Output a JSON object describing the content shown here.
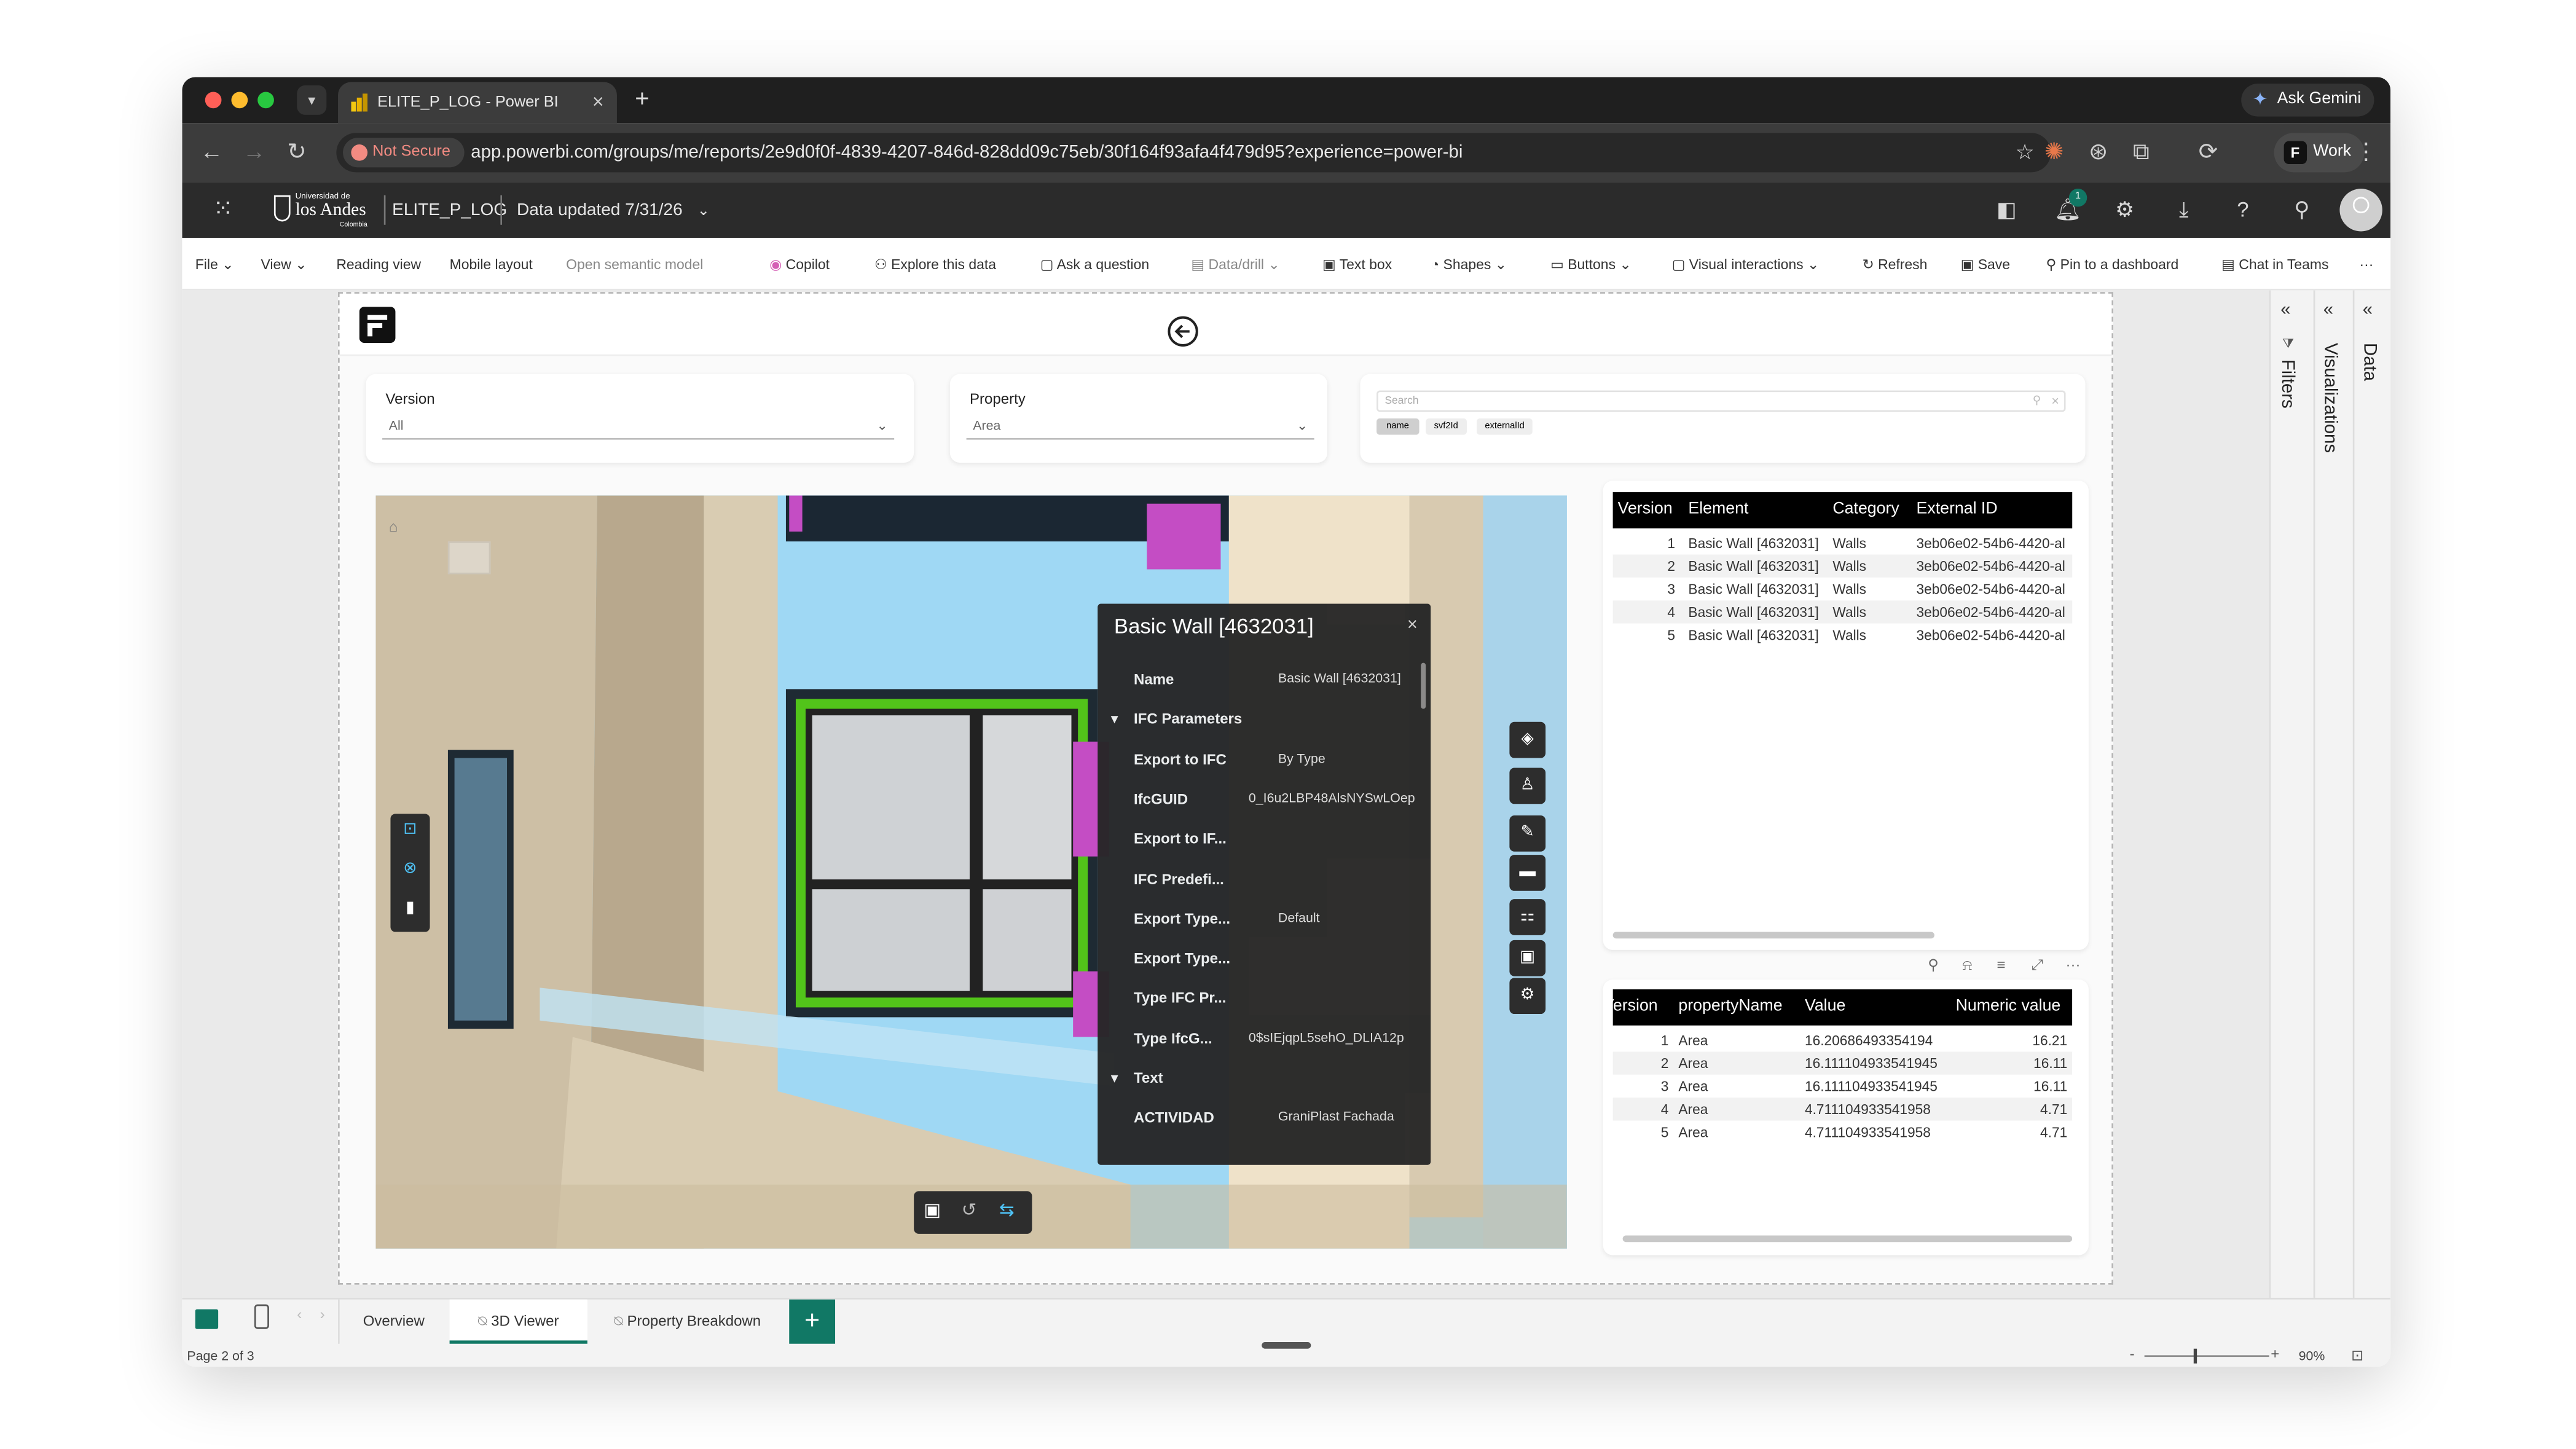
{
  "browser": {
    "tab_title": "ELITE_P_LOG - Power BI",
    "new_tab_symbol": "+",
    "tab_close_symbol": "×",
    "not_secure_label": "Not Secure",
    "url": "app.powerbi.com/groups/me/reports/2e9d0f0f-4839-4207-846d-828dd09c75eb/30f164f93afa4f479d95?experience=power-bi",
    "ask_gemini_label": "Ask Gemini",
    "profile_label": "Work"
  },
  "pbi_header": {
    "org_name_top": "Universidad de",
    "org_name_main": "los Andes",
    "org_name_sub": "Colombia",
    "report_name": "ELITE_P_LOG",
    "data_updated": "Data updated 7/31/26"
  },
  "ribbon": {
    "file": "File",
    "view": "View",
    "reading_view": "Reading view",
    "mobile_layout": "Mobile layout",
    "open_semantic_model": "Open semantic model",
    "copilot": "Copilot",
    "explore": "Explore this data",
    "ask_question": "Ask a question",
    "data_drill": "Data/drill",
    "text_box": "Text box",
    "shapes": "Shapes",
    "buttons": "Buttons",
    "visual_interactions": "Visual interactions",
    "refresh": "Refresh",
    "save": "Save",
    "pin": "Pin to a dashboard",
    "chat_teams": "Chat in Teams",
    "more": "···"
  },
  "filters": {
    "version_label": "Version",
    "version_value": "All",
    "property_label": "Property",
    "property_value": "Area",
    "search_placeholder": "Search",
    "search_chips": [
      "name",
      "svf2Id",
      "externalId"
    ]
  },
  "viewer": {
    "panel_title": "Basic Wall [4632031]",
    "rows": [
      {
        "key": "Name",
        "value": "Basic Wall [4632031]",
        "section": false
      },
      {
        "key": "IFC Parameters",
        "value": "",
        "section": true
      },
      {
        "key": "Export to IFC",
        "value": "By Type",
        "section": false
      },
      {
        "key": "IfcGUID",
        "value": "0_I6u2LBP48AlsNYSwLOep",
        "section": false
      },
      {
        "key": "Export to IF...",
        "value": "",
        "section": false
      },
      {
        "key": "IFC Predefi...",
        "value": "",
        "section": false
      },
      {
        "key": "Export Type...",
        "value": "Default",
        "section": false
      },
      {
        "key": "Export Type...",
        "value": "",
        "section": false
      },
      {
        "key": "Type IFC Pr...",
        "value": "",
        "section": false
      },
      {
        "key": "Type IfcG...",
        "value": "0$sIEjqpL5sehO_DLIA12p",
        "section": false
      },
      {
        "key": "Text",
        "value": "",
        "section": true
      },
      {
        "key": "ACTIVIDAD",
        "value": "GraniPlast Fachada",
        "section": false
      }
    ]
  },
  "elements_table": {
    "headers": [
      "Version",
      "Element",
      "Category",
      "External ID"
    ],
    "rows": [
      [
        "1",
        "Basic Wall [4632031]",
        "Walls",
        "3eb06e02-54b6-4420-al"
      ],
      [
        "2",
        "Basic Wall [4632031]",
        "Walls",
        "3eb06e02-54b6-4420-al"
      ],
      [
        "3",
        "Basic Wall [4632031]",
        "Walls",
        "3eb06e02-54b6-4420-al"
      ],
      [
        "4",
        "Basic Wall [4632031]",
        "Walls",
        "3eb06e02-54b6-4420-al"
      ],
      [
        "5",
        "Basic Wall [4632031]",
        "Walls",
        "3eb06e02-54b6-4420-al"
      ]
    ]
  },
  "property_table": {
    "headers": [
      "Version",
      "propertyName",
      "Value",
      "Numeric value"
    ],
    "rows": [
      [
        "1",
        "Area",
        "16.20686493354194",
        "16.21"
      ],
      [
        "2",
        "Area",
        "16.111104933541945",
        "16.11"
      ],
      [
        "3",
        "Area",
        "16.111104933541945",
        "16.11"
      ],
      [
        "4",
        "Area",
        "4.711104933541958",
        "4.71"
      ],
      [
        "5",
        "Area",
        "4.711104933541958",
        "4.71"
      ]
    ]
  },
  "side_panes": {
    "filters": "Filters",
    "visualizations": "Visualizations",
    "data": "Data"
  },
  "bottom": {
    "tabs": [
      "Overview",
      "3D Viewer",
      "Property Breakdown"
    ],
    "add_page": "+",
    "page_status": "Page 2 of 3",
    "zoom": "90%",
    "zoom_minus": "-",
    "zoom_plus": "+"
  },
  "colors": {
    "accent_green": "#117865",
    "notsecure_red": "#f28b82",
    "viewer_sky": "#9fd8f4",
    "highlight_green": "#52c41a",
    "wall_magenta": "#c44dc4"
  }
}
